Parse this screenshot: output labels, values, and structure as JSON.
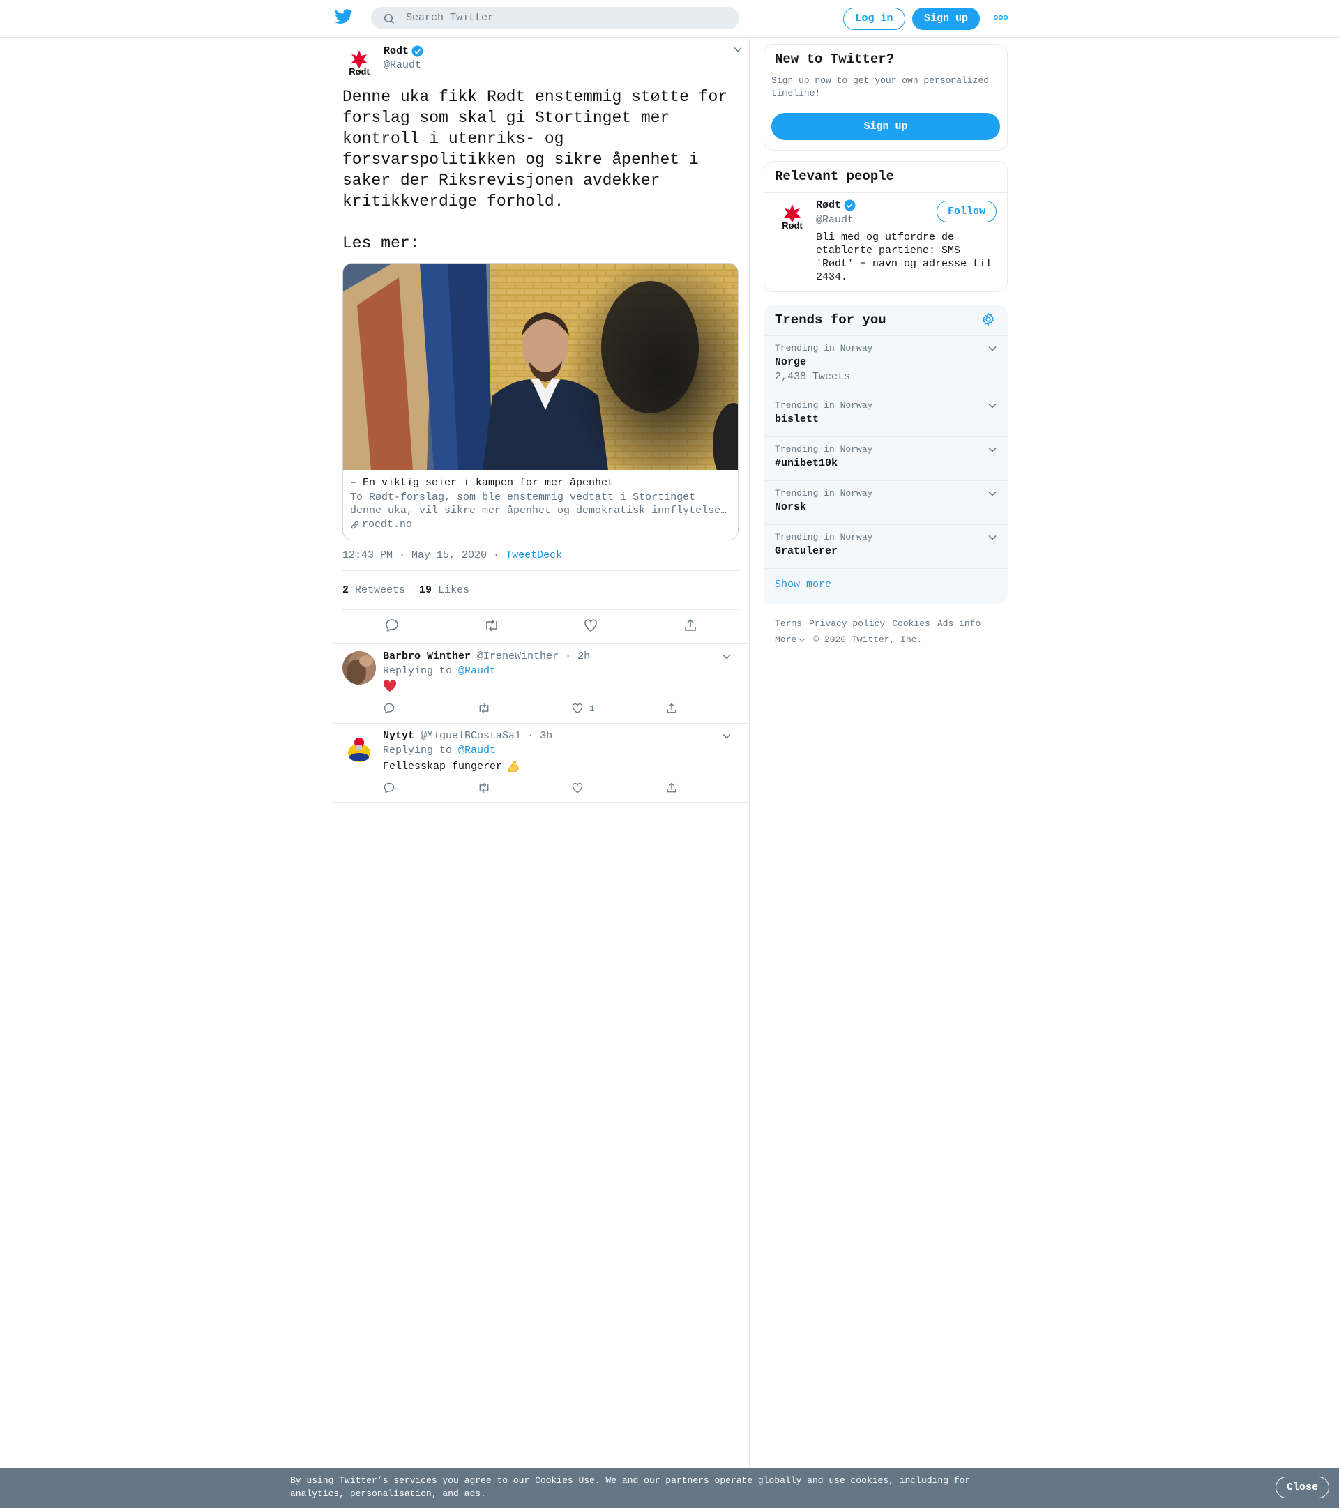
{
  "topbar": {
    "search_placeholder": "Search Twitter",
    "login_label": "Log in",
    "signup_label": "Sign up"
  },
  "tweet": {
    "author_name": "Rødt",
    "author_handle": "@Raudt",
    "logo_text": "Rødt",
    "text": "Denne uka fikk Rødt enstemmig støtte for\nforslag som skal gi Stortinget mer\nkontroll i utenriks- og\nforsvarspolitikken og sikre åpenhet i\nsaker der Riksrevisjonen avdekker\nkritikkverdige forhold.\n\nLes mer:",
    "card": {
      "title": "– En viktig seier i kampen for mer åpenhet",
      "desc_line1": "To Rødt-forslag, som ble enstemmig vedtatt i Stortinget",
      "desc_line2": "denne uka, vil sikre mer åpenhet og demokratisk innflytelse…",
      "domain": "roedt.no"
    },
    "timestamp": "12:43 PM · May 15, 2020",
    "source": "TweetDeck",
    "retweets_count": "2",
    "retweets_label": "Retweets",
    "likes_count": "19",
    "likes_label": "Likes"
  },
  "replies": [
    {
      "name": "Barbro Winther",
      "handle": "@IreneWinther",
      "time": "· 2h",
      "replying_prefix": "Replying to",
      "replying_to": "@Raudt",
      "body": "",
      "like_count": "1"
    },
    {
      "name": "Nytyt",
      "handle": "@MiguelBCostaSa1",
      "time": "· 3h",
      "replying_prefix": "Replying to",
      "replying_to": "@Raudt",
      "body": "Fellesskap fungerer",
      "like_count": ""
    }
  ],
  "sidebar": {
    "new_title": "New to Twitter?",
    "new_desc": "Sign up now to get your own personalized timeline!",
    "signup_label": "Sign up",
    "relevant_title": "Relevant people",
    "person": {
      "name": "Rødt",
      "handle": "@Raudt",
      "follow_label": "Follow",
      "bio": "Bli med og utfordre de etablerte partiene: SMS 'Rødt' + navn og adresse til 2434."
    },
    "trends_title": "Trends for you",
    "trends": [
      {
        "label": "Trending in Norway",
        "name": "Norge",
        "count": "2,438 Tweets"
      },
      {
        "label": "Trending in Norway",
        "name": "bislett",
        "count": ""
      },
      {
        "label": "Trending in Norway",
        "name": "#unibet10k",
        "count": ""
      },
      {
        "label": "Trending in Norway",
        "name": "Norsk",
        "count": ""
      },
      {
        "label": "Trending in Norway",
        "name": "Gratulerer",
        "count": ""
      }
    ],
    "show_more": "Show more",
    "footer": {
      "terms": "Terms",
      "privacy": "Privacy policy",
      "cookies": "Cookies",
      "ads": "Ads info",
      "more": "More",
      "copyright": "© 2020 Twitter, Inc."
    }
  },
  "cookie_banner": {
    "text_before": "By using Twitter’s services you agree to our ",
    "link": "Cookies Use",
    "text_after": ". We and our partners operate globally and use cookies, including for analytics, personalisation, and ads.",
    "close_label": "Close"
  },
  "colors": {
    "accent": "#1da1f2",
    "link": "#1b95e0",
    "muted": "#657786",
    "text": "#14171a",
    "brand_red": "#e4002b"
  }
}
